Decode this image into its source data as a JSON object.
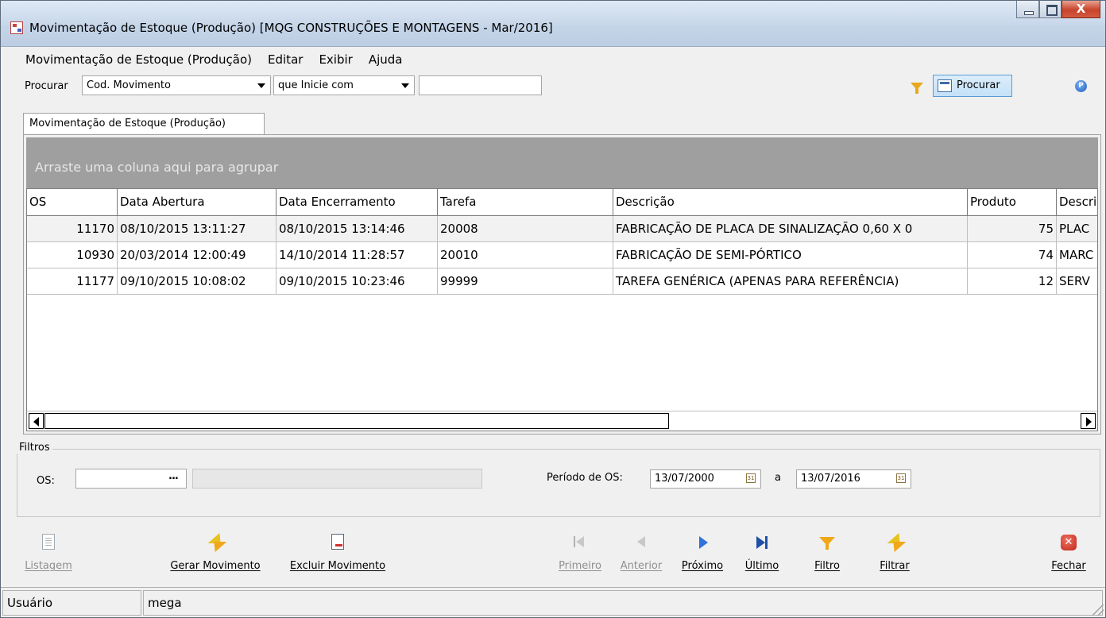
{
  "window": {
    "title": "Movimentação de Estoque (Produção) [MQG CONSTRUÇÕES E MONTAGENS - Mar/2016]"
  },
  "menubar": {
    "items": [
      "Movimentação de Estoque (Produção)",
      "Editar",
      "Exibir",
      "Ajuda"
    ]
  },
  "search": {
    "label": "Procurar",
    "field_value": "Cod. Movimento",
    "operator_value": "que Inicie com",
    "text_value": "",
    "button_label": "Procurar"
  },
  "tab": {
    "label": "Movimentação de Estoque (Produção)"
  },
  "grid": {
    "group_hint": "Arraste uma coluna aqui para agrupar",
    "columns": [
      "OS",
      "Data Abertura",
      "Data Encerramento",
      "Tarefa",
      "Descrição",
      "Produto",
      "Descri"
    ],
    "rows": [
      [
        "11170",
        "08/10/2015 13:11:27",
        "08/10/2015 13:14:46",
        "20008",
        "FABRICAÇÃO DE PLACA DE SINALIZAÇÃO 0,60 X 0",
        "75",
        "PLAC"
      ],
      [
        "10930",
        "20/03/2014 12:00:49",
        "14/10/2014 11:28:57",
        "20010",
        "FABRICAÇÃO DE SEMI-PÓRTICO",
        "74",
        "MARC"
      ],
      [
        "11177",
        "09/10/2015 10:08:02",
        "09/10/2015 10:23:46",
        "99999",
        "TAREFA GENÉRICA (APENAS PARA REFERÊNCIA)",
        "12",
        "SERV"
      ]
    ]
  },
  "filters": {
    "legend": "Filtros",
    "os_label": "OS:",
    "os_value": "",
    "os_lookup": "...",
    "os_description": "",
    "period_label": "Período de OS:",
    "date_from": "13/07/2000",
    "date_sep": "a",
    "date_to": "13/07/2016"
  },
  "toolbar": {
    "listagem": "Listagem",
    "gerar": "Gerar Movimento",
    "excluir": "Excluir Movimento",
    "primeiro": "Primeiro",
    "anterior": "Anterior",
    "proximo": "Próximo",
    "ultimo": "Último",
    "filtro": "Filtro",
    "filtrar": "Filtrar",
    "fechar": "Fechar"
  },
  "statusbar": {
    "label": "Usuário",
    "value": "mega"
  },
  "colors": {
    "group_area": "#9f9f9f",
    "selected_row": "#f2f2f2",
    "accent_blue": "#2f72d8",
    "close_red": "#c8442c"
  }
}
